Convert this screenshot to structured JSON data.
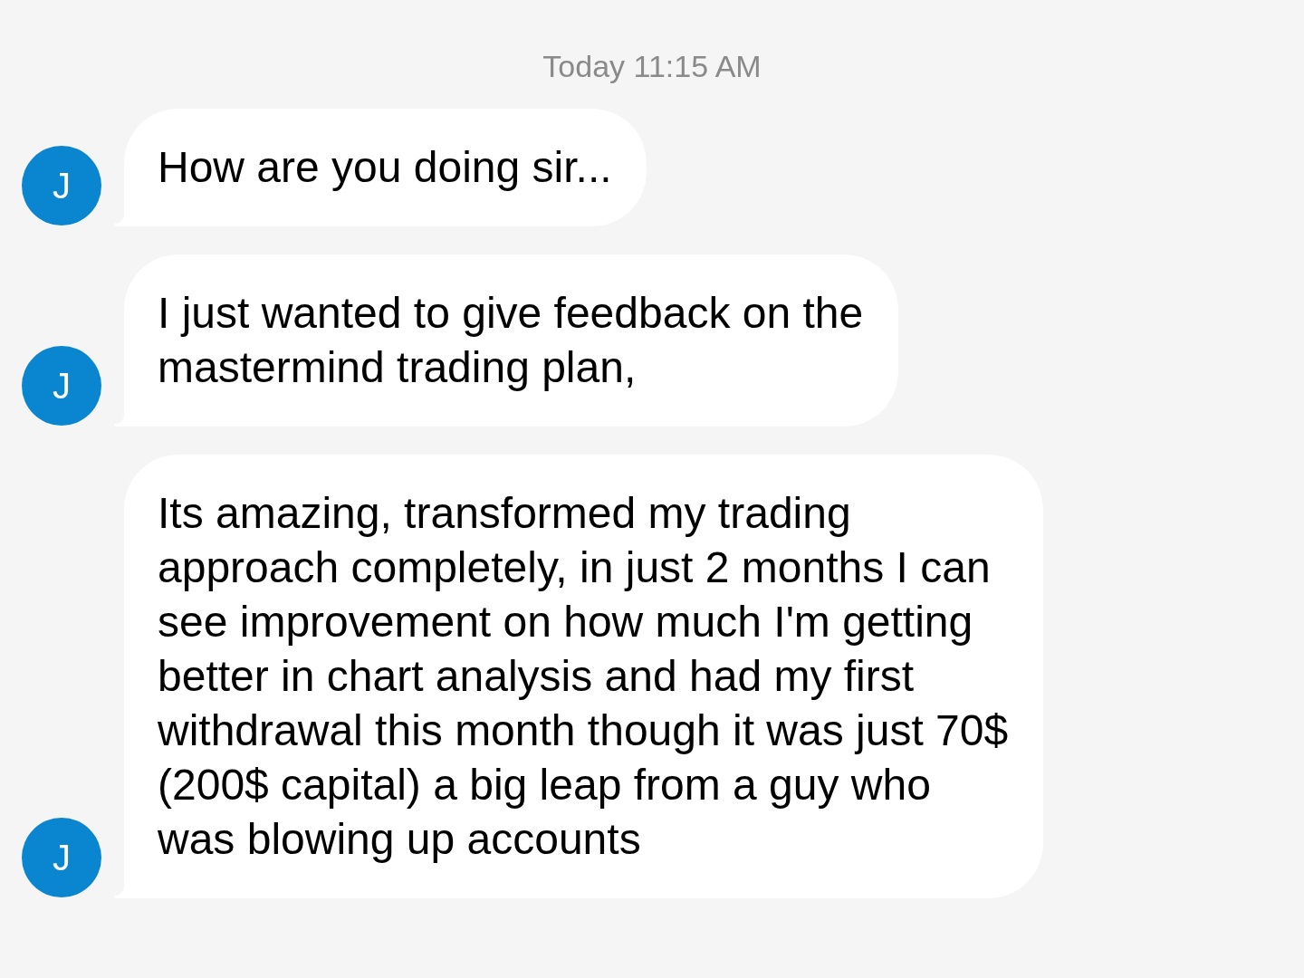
{
  "timestamp": "Today 11:15 AM",
  "messages": [
    {
      "avatar": "J",
      "text": "How are you doing sir..."
    },
    {
      "avatar": "J",
      "text": "I just wanted to give feedback on the mastermind trading plan,"
    },
    {
      "avatar": "J",
      "text": "Its amazing, transformed my trading approach completely, in just 2 months I can see improvement on how much I'm getting better in chart analysis and had my first withdrawal this month though it was just 70$ (200$ capital) a big leap from a guy who was blowing up accounts"
    }
  ]
}
